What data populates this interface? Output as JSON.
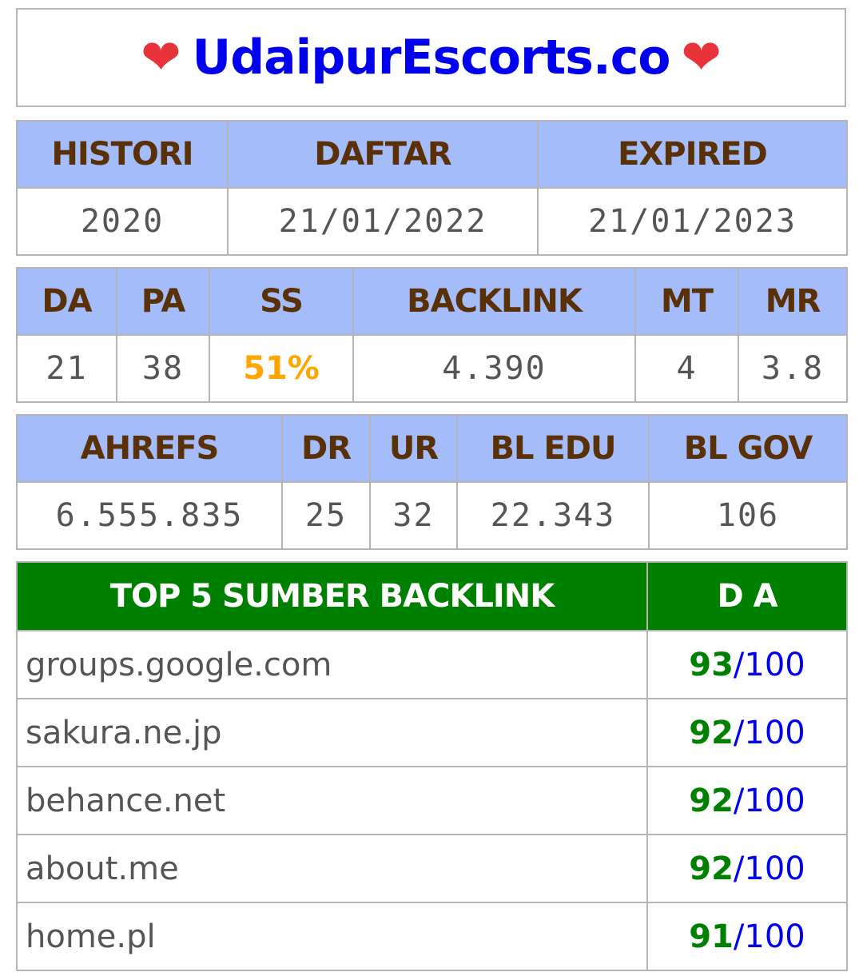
{
  "header": {
    "heart_left": "❤",
    "site_name": "UdaipurEscorts.co",
    "heart_right": "❤"
  },
  "domain_info": {
    "headers": [
      "HISTORI",
      "DAFTAR",
      "EXPIRED"
    ],
    "values": [
      "2020",
      "21/01/2022",
      "21/01/2023"
    ]
  },
  "moz": {
    "headers": [
      "DA",
      "PA",
      "SS",
      "BACKLINK",
      "MT",
      "MR"
    ],
    "values": [
      "21",
      "38",
      "51%",
      "4.390",
      "4",
      "3.8"
    ]
  },
  "ahrefs": {
    "headers": [
      "AHREFS",
      "DR",
      "UR",
      "BL EDU",
      "BL GOV"
    ],
    "values": [
      "6.555.835",
      "25",
      "32",
      "22.343",
      "106"
    ]
  },
  "top_backlinks": {
    "header_source": "TOP 5 SUMBER BACKLINK",
    "header_da": "D A",
    "separator": "/",
    "max": "100",
    "rows": [
      {
        "domain": "groups.google.com",
        "da": "93"
      },
      {
        "domain": "sakura.ne.jp",
        "da": "92"
      },
      {
        "domain": "behance.net",
        "da": "92"
      },
      {
        "domain": "about.me",
        "da": "92"
      },
      {
        "domain": "home.pl",
        "da": "91"
      }
    ]
  },
  "colors": {
    "header_bg": "#a4bcfa",
    "header_text": "#5a3106",
    "top_header_bg": "#008000",
    "site_name": "#0000ee",
    "ss_value": "#ffa500",
    "heart": "#e8333b"
  }
}
